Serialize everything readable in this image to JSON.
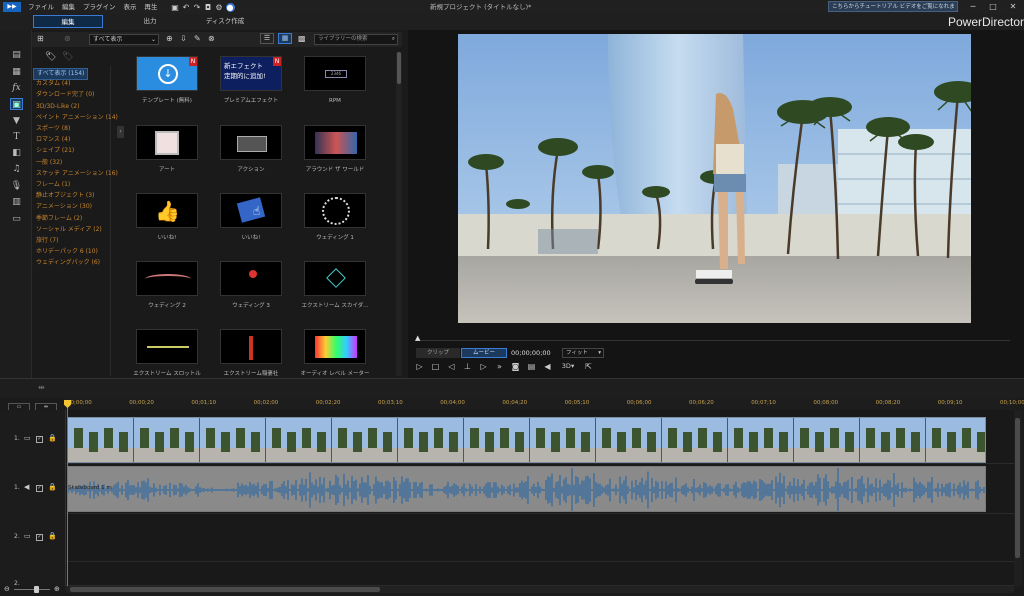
{
  "menu": {
    "items": [
      "ファイル",
      "編集",
      "プラグイン",
      "表示",
      "再生"
    ]
  },
  "window": {
    "title": "新規プロジェクト (タイトルなし)*",
    "tip": "こちらからチュートリアル ビデオをご覧になれます。"
  },
  "modes": {
    "edit": "編集",
    "output": "出力",
    "disc": "ディスク作成"
  },
  "brand": "PowerDirector",
  "library": {
    "filter": "すべて表示",
    "search_placeholder": "ライブラリーの検索",
    "categories": [
      {
        "label": "すべて表示 (154)",
        "selected": true
      },
      {
        "label": "カスタム (4)"
      },
      {
        "label": "ダウンロード完了 (0)"
      },
      {
        "label": "3D/3D-Like (2)"
      },
      {
        "label": "ペイント アニメーション (14)"
      },
      {
        "label": "スポーツ (8)"
      },
      {
        "label": "ロマンス (4)"
      },
      {
        "label": "シェイプ (21)"
      },
      {
        "label": "一般 (32)"
      },
      {
        "label": "スケッチ アニメーション (16)"
      },
      {
        "label": "フレーム (1)"
      },
      {
        "label": "静止オブジェクト (3)"
      },
      {
        "label": "アニメーション (30)"
      },
      {
        "label": "季節フレーム (2)"
      },
      {
        "label": "ソーシャル メディア (2)"
      },
      {
        "label": "旅行 (7)"
      },
      {
        "label": "ホリデーパック 6 (10)"
      },
      {
        "label": "ウェディングパック (6)"
      }
    ],
    "tiles": [
      {
        "label": "テンプレート (無料)",
        "badge": "N",
        "thumb_text": "",
        "kind": "download"
      },
      {
        "label": "プレミアムエフェクト",
        "badge": "N",
        "thumb_text": "新エフェクト\n定期的に追加!",
        "kind": "premium"
      },
      {
        "label": "RPM",
        "badge": "",
        "thumb_text": "",
        "kind": "rpm"
      },
      {
        "label": "アート",
        "badge": "",
        "thumb_text": "",
        "kind": "art"
      },
      {
        "label": "アクション",
        "badge": "",
        "thumb_text": "",
        "kind": "action"
      },
      {
        "label": "アラウンド ザ ワールド",
        "badge": "",
        "thumb_text": "",
        "kind": "world"
      },
      {
        "label": "いいね!",
        "badge": "",
        "thumb_text": "",
        "kind": "like1"
      },
      {
        "label": "いいね!",
        "badge": "",
        "thumb_text": "",
        "kind": "like2"
      },
      {
        "label": "ウェディング 1",
        "badge": "",
        "thumb_text": "",
        "kind": "wed1"
      },
      {
        "label": "ウェディング 2",
        "badge": "",
        "thumb_text": "",
        "kind": "wed2"
      },
      {
        "label": "ウェディング 3",
        "badge": "",
        "thumb_text": "",
        "kind": "wed3"
      },
      {
        "label": "エクストリーム スカイダ...",
        "badge": "",
        "thumb_text": "",
        "kind": "sky"
      },
      {
        "label": "エクストリーム スロットル",
        "badge": "",
        "thumb_text": "",
        "kind": "x1"
      },
      {
        "label": "エクストリーム稲妻社",
        "badge": "",
        "thumb_text": "",
        "kind": "x2"
      },
      {
        "label": "オーディオ レベル メーター",
        "badge": "",
        "thumb_text": "",
        "kind": "meter"
      }
    ]
  },
  "player": {
    "clip_tab": "クリップ",
    "movie_tab": "ムービー",
    "timecode": "00;00;00;00",
    "fit": "フィット",
    "mode_3d": "3D"
  },
  "timeline": {
    "ticks": [
      "00;00;00",
      "00;00;20",
      "00;01;10",
      "00;02;00",
      "00;02;20",
      "00;03;10",
      "00;04;00",
      "00;04;20",
      "00;05;10",
      "00;06;00",
      "00;06;20",
      "00;07;10",
      "00;08;00",
      "00;08;20",
      "00;09;10",
      "00;10;00"
    ],
    "tracks": [
      {
        "label": "1."
      },
      {
        "label": "1."
      },
      {
        "label": "2."
      },
      {
        "label": "2."
      }
    ],
    "audio_clip_label": "Skateboard 1 m"
  },
  "colors": {
    "accent": "#3a7bd5",
    "category_text": "#c8852e",
    "tick_text": "#c8a34e",
    "playhead": "#ee4433"
  }
}
